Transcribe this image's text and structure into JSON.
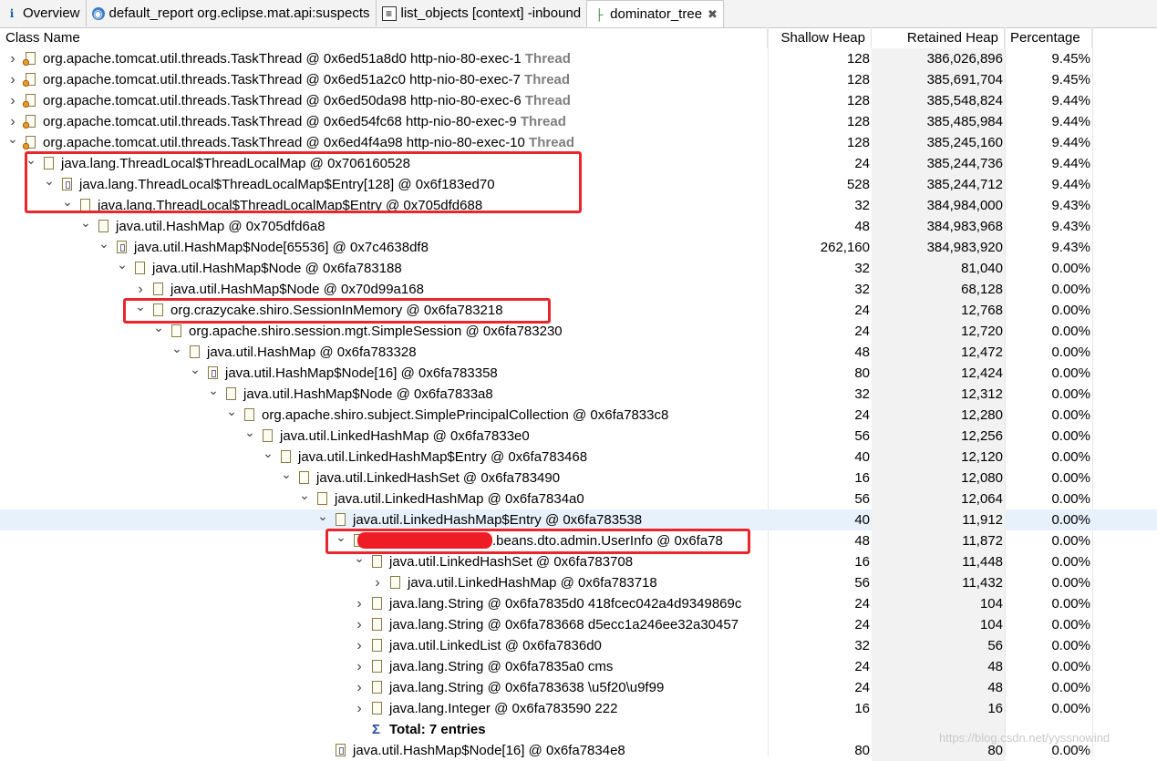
{
  "tabs": [
    {
      "label": "Overview",
      "icon": "info-icon"
    },
    {
      "label": "default_report  org.eclipse.mat.api:suspects",
      "icon": "report-icon"
    },
    {
      "label": "list_objects [context] -inbound",
      "icon": "list-icon"
    },
    {
      "label": "dominator_tree",
      "icon": "tree-icon",
      "active": true
    }
  ],
  "columns": {
    "name": "Class Name",
    "shallow": "Shallow Heap",
    "retained": "Retained Heap",
    "pct": "Percentage"
  },
  "rows": [
    {
      "d": 0,
      "t": ">",
      "ic": "thr",
      "name": "org.apache.tomcat.util.threads.TaskThread @ 0x6ed51a8d0  http-nio-80-exec-1",
      "attr": "Thread",
      "sh": "128",
      "rh": "386,026,896",
      "pc": "9.45%"
    },
    {
      "d": 0,
      "t": ">",
      "ic": "thr",
      "name": "org.apache.tomcat.util.threads.TaskThread @ 0x6ed51a2c0  http-nio-80-exec-7",
      "attr": "Thread",
      "sh": "128",
      "rh": "385,691,704",
      "pc": "9.45%"
    },
    {
      "d": 0,
      "t": ">",
      "ic": "thr",
      "name": "org.apache.tomcat.util.threads.TaskThread @ 0x6ed50da98  http-nio-80-exec-6",
      "attr": "Thread",
      "sh": "128",
      "rh": "385,548,824",
      "pc": "9.44%"
    },
    {
      "d": 0,
      "t": ">",
      "ic": "thr",
      "name": "org.apache.tomcat.util.threads.TaskThread @ 0x6ed54fc68  http-nio-80-exec-9",
      "attr": "Thread",
      "sh": "128",
      "rh": "385,485,984",
      "pc": "9.44%"
    },
    {
      "d": 0,
      "t": "v",
      "ic": "thr",
      "name": "org.apache.tomcat.util.threads.TaskThread @ 0x6ed4f4a98  http-nio-80-exec-10",
      "attr": "Thread",
      "sh": "128",
      "rh": "385,245,160",
      "pc": "9.44%"
    },
    {
      "d": 1,
      "t": "v",
      "ic": "obj",
      "name": "java.lang.ThreadLocal$ThreadLocalMap @ 0x706160528",
      "sh": "24",
      "rh": "385,244,736",
      "pc": "9.44%"
    },
    {
      "d": 2,
      "t": "v",
      "ic": "arr",
      "name": "java.lang.ThreadLocal$ThreadLocalMap$Entry[128] @ 0x6f183ed70",
      "sh": "528",
      "rh": "385,244,712",
      "pc": "9.44%"
    },
    {
      "d": 3,
      "t": "v",
      "ic": "obj",
      "name": "java.lang.ThreadLocal$ThreadLocalMap$Entry @ 0x705dfd688",
      "sh": "32",
      "rh": "384,984,000",
      "pc": "9.43%"
    },
    {
      "d": 4,
      "t": "v",
      "ic": "obj",
      "name": "java.util.HashMap @ 0x705dfd6a8",
      "sh": "48",
      "rh": "384,983,968",
      "pc": "9.43%"
    },
    {
      "d": 5,
      "t": "v",
      "ic": "arr",
      "name": "java.util.HashMap$Node[65536] @ 0x7c4638df8",
      "sh": "262,160",
      "rh": "384,983,920",
      "pc": "9.43%"
    },
    {
      "d": 6,
      "t": "v",
      "ic": "obj",
      "name": "java.util.HashMap$Node @ 0x6fa783188",
      "sh": "32",
      "rh": "81,040",
      "pc": "0.00%"
    },
    {
      "d": 7,
      "t": ">",
      "ic": "obj",
      "name": "java.util.HashMap$Node @ 0x70d99a168",
      "sh": "32",
      "rh": "68,128",
      "pc": "0.00%"
    },
    {
      "d": 7,
      "t": "v",
      "ic": "obj",
      "name": "org.crazycake.shiro.SessionInMemory @ 0x6fa783218",
      "sh": "24",
      "rh": "12,768",
      "pc": "0.00%"
    },
    {
      "d": 8,
      "t": "v",
      "ic": "obj",
      "name": "org.apache.shiro.session.mgt.SimpleSession @ 0x6fa783230",
      "sh": "24",
      "rh": "12,720",
      "pc": "0.00%"
    },
    {
      "d": 9,
      "t": "v",
      "ic": "obj",
      "name": "java.util.HashMap @ 0x6fa783328",
      "sh": "48",
      "rh": "12,472",
      "pc": "0.00%"
    },
    {
      "d": 10,
      "t": "v",
      "ic": "arr",
      "name": "java.util.HashMap$Node[16] @ 0x6fa783358",
      "sh": "80",
      "rh": "12,424",
      "pc": "0.00%"
    },
    {
      "d": 11,
      "t": "v",
      "ic": "obj",
      "name": "java.util.HashMap$Node @ 0x6fa7833a8",
      "sh": "32",
      "rh": "12,312",
      "pc": "0.00%"
    },
    {
      "d": 12,
      "t": "v",
      "ic": "obj",
      "name": "org.apache.shiro.subject.SimplePrincipalCollection @ 0x6fa7833c8",
      "sh": "24",
      "rh": "12,280",
      "pc": "0.00%"
    },
    {
      "d": 13,
      "t": "v",
      "ic": "obj",
      "name": "java.util.LinkedHashMap @ 0x6fa7833e0",
      "sh": "56",
      "rh": "12,256",
      "pc": "0.00%"
    },
    {
      "d": 14,
      "t": "v",
      "ic": "obj",
      "name": "java.util.LinkedHashMap$Entry @ 0x6fa783468",
      "sh": "40",
      "rh": "12,120",
      "pc": "0.00%"
    },
    {
      "d": 15,
      "t": "v",
      "ic": "obj",
      "name": "java.util.LinkedHashSet @ 0x6fa783490",
      "sh": "16",
      "rh": "12,080",
      "pc": "0.00%"
    },
    {
      "d": 16,
      "t": "v",
      "ic": "obj",
      "name": "java.util.LinkedHashMap @ 0x6fa7834a0",
      "sh": "56",
      "rh": "12,064",
      "pc": "0.00%"
    },
    {
      "d": 17,
      "t": "v",
      "ic": "obj",
      "name": "java.util.LinkedHashMap$Entry @ 0x6fa783538",
      "sh": "40",
      "rh": "11,912",
      "pc": "0.00%",
      "sel": true
    },
    {
      "d": 18,
      "t": "v",
      "ic": "obj",
      "name": ".beans.dto.admin.UserInfo @ 0x6fa78",
      "sh": "48",
      "rh": "11,872",
      "pc": "0.00%",
      "redacted": true
    },
    {
      "d": 19,
      "t": "v",
      "ic": "obj",
      "name": "java.util.LinkedHashSet @ 0x6fa783708",
      "sh": "16",
      "rh": "11,448",
      "pc": "0.00%"
    },
    {
      "d": 20,
      "t": ">",
      "ic": "obj",
      "name": "java.util.LinkedHashMap @ 0x6fa783718",
      "sh": "56",
      "rh": "11,432",
      "pc": "0.00%"
    },
    {
      "d": 19,
      "t": ">",
      "ic": "obj",
      "name": "java.lang.String @ 0x6fa7835d0  418fcec042a4d9349869c",
      "sh": "24",
      "rh": "104",
      "pc": "0.00%"
    },
    {
      "d": 19,
      "t": ">",
      "ic": "obj",
      "name": "java.lang.String @ 0x6fa783668  d5ecc1a246ee32a30457",
      "sh": "24",
      "rh": "104",
      "pc": "0.00%"
    },
    {
      "d": 19,
      "t": ">",
      "ic": "obj",
      "name": "java.util.LinkedList @ 0x6fa7836d0",
      "sh": "32",
      "rh": "56",
      "pc": "0.00%"
    },
    {
      "d": 19,
      "t": ">",
      "ic": "obj",
      "name": "java.lang.String @ 0x6fa7835a0  cms",
      "sh": "24",
      "rh": "48",
      "pc": "0.00%"
    },
    {
      "d": 19,
      "t": ">",
      "ic": "obj",
      "name": "java.lang.String @ 0x6fa783638  \\u5f20\\u9f99",
      "sh": "24",
      "rh": "48",
      "pc": "0.00%"
    },
    {
      "d": 19,
      "t": ">",
      "ic": "obj",
      "name": "java.lang.Integer @ 0x6fa783590  222",
      "sh": "16",
      "rh": "16",
      "pc": "0.00%"
    },
    {
      "d": 19,
      "t": "",
      "ic": "sigma",
      "name": "Total: 7 entries",
      "sh": "",
      "rh": "",
      "pc": "",
      "bold": true
    },
    {
      "d": 17,
      "t": "",
      "ic": "arr",
      "name": "java.util.HashMap$Node[16] @ 0x6fa7834e8",
      "sh": "80",
      "rh": "80",
      "pc": "0.00%"
    }
  ],
  "watermark": "https://blog.csdn.net/yyssnowind"
}
